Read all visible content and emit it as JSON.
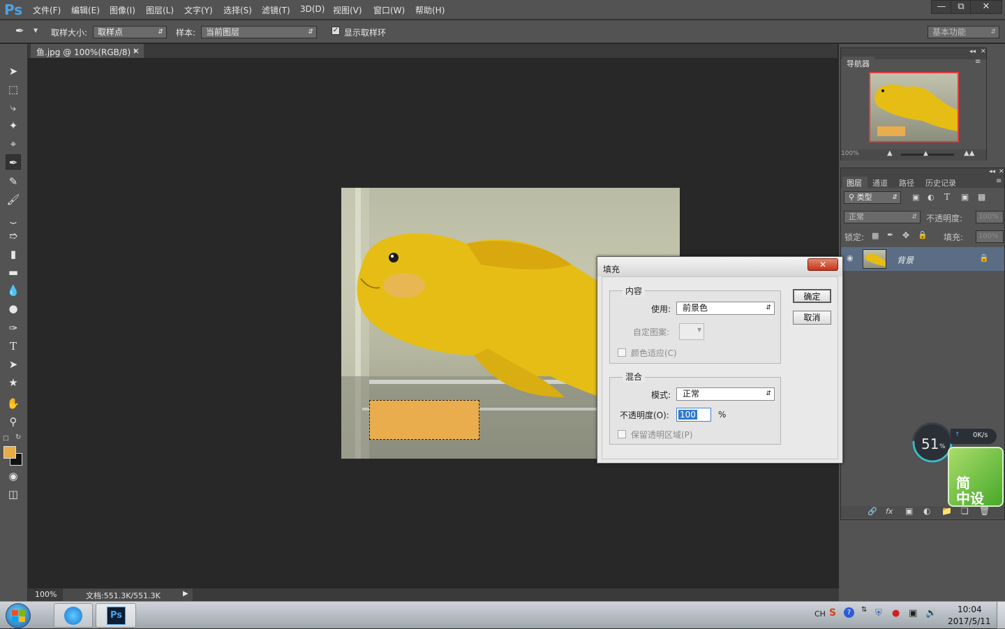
{
  "app": {
    "logo": "Ps"
  },
  "menu": [
    "文件(F)",
    "编辑(E)",
    "图像(I)",
    "图层(L)",
    "文字(Y)",
    "选择(S)",
    "滤镜(T)",
    "3D(D)",
    "视图(V)",
    "窗口(W)",
    "帮助(H)"
  ],
  "options": {
    "sample_size_label": "取样大小:",
    "sample_size_value": "取样点",
    "sample_label": "样本:",
    "sample_value": "当前图层",
    "show_ring_label": "显示取样环",
    "show_ring_checked": true,
    "workspace": "基本功能"
  },
  "document": {
    "tab_title": "鱼.jpg @ 100%(RGB/8) *",
    "zoom": "100%",
    "doc_size": "文档:551.3K/551.3K"
  },
  "colors": {
    "foreground": "#e8ac48",
    "selection_fill": "#e9ad4d"
  },
  "navigator": {
    "title": "导航器",
    "zoom": "100%"
  },
  "layers_panel": {
    "tabs": [
      "图层",
      "通道",
      "路径",
      "历史记录"
    ],
    "filter_label": "类型",
    "blend_mode": "正常",
    "opacity_label": "不透明度:",
    "opacity_value": "100%",
    "lock_label": "锁定:",
    "fill_label": "填充:",
    "fill_value": "100%",
    "layer_name": "背景"
  },
  "dialog": {
    "title": "填充",
    "content_group": "内容",
    "use_label": "使用:",
    "use_value": "前景色",
    "custom_pattern_label": "自定图案:",
    "color_adapt_label": "颜色适应(C)",
    "blend_group": "混合",
    "mode_label": "模式:",
    "mode_value": "正常",
    "opacity_label": "不透明度(O):",
    "opacity_value": "100",
    "percent": "%",
    "preserve_label": "保留透明区域(P)",
    "ok": "确定",
    "cancel": "取消"
  },
  "widget": {
    "percent": "51",
    "unit": "%",
    "speed": "0K/s",
    "badge_line1": "简",
    "badge_line2": "中设"
  },
  "taskbar": {
    "lang": "CH",
    "time": "10:04",
    "date": "2017/5/11",
    "ps_label": "Ps"
  }
}
